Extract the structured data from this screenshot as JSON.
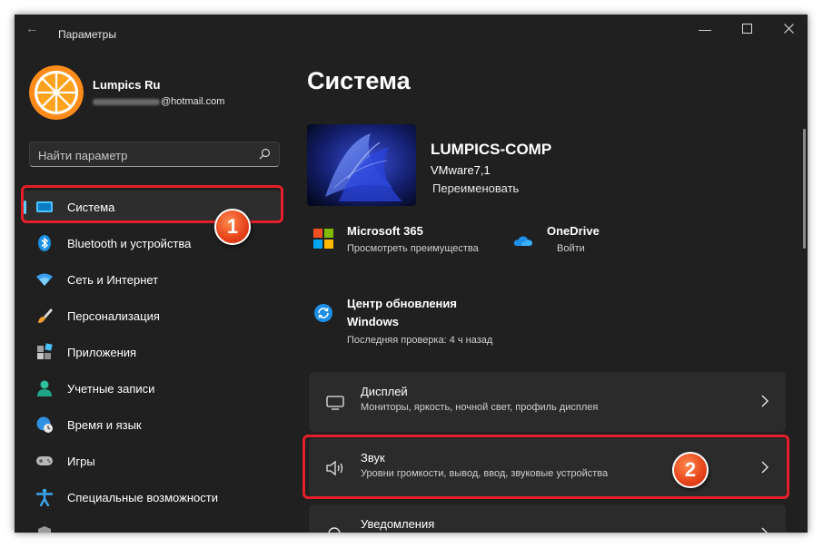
{
  "window": {
    "title": "Параметры"
  },
  "user": {
    "name": "Lumpics Ru",
    "email_domain": "@hotmail.com"
  },
  "search": {
    "placeholder": "Найти параметр"
  },
  "sidebar": {
    "items": [
      {
        "label": "Система",
        "icon": "monitor-icon",
        "selected": true
      },
      {
        "label": "Bluetooth и устройства",
        "icon": "bluetooth-icon"
      },
      {
        "label": "Сеть и Интернет",
        "icon": "wifi-icon"
      },
      {
        "label": "Персонализация",
        "icon": "brush-icon"
      },
      {
        "label": "Приложения",
        "icon": "apps-icon"
      },
      {
        "label": "Учетные записи",
        "icon": "person-icon"
      },
      {
        "label": "Время и язык",
        "icon": "globe-clock-icon"
      },
      {
        "label": "Игры",
        "icon": "gamepad-icon"
      },
      {
        "label": "Специальные возможности",
        "icon": "accessibility-icon"
      }
    ]
  },
  "main": {
    "title": "Система",
    "device": {
      "name": "LUMPICS-COMP",
      "model": "VMware7,1",
      "rename": "Переименовать"
    },
    "services": [
      {
        "title": "Microsoft 365",
        "subtitle": "Просмотреть преимущества",
        "icon": "microsoft-logo-icon"
      },
      {
        "title": "OneDrive",
        "subtitle": "Войти",
        "icon": "onedrive-cloud-icon"
      }
    ],
    "update": {
      "title_line1": "Центр обновления",
      "title_line2": "Windows",
      "subtitle": "Последняя проверка: 4 ч назад",
      "icon": "sync-icon"
    },
    "cards": [
      {
        "title": "Дисплей",
        "subtitle": "Мониторы, яркость, ночной свет, профиль дисплея",
        "icon": "display-icon"
      },
      {
        "title": "Звук",
        "subtitle": "Уровни громкости, вывод, ввод, звуковые устройства",
        "icon": "speaker-icon"
      },
      {
        "title": "Уведомления",
        "subtitle": "",
        "icon": "bell-icon"
      }
    ]
  },
  "annotations": {
    "step1": "1",
    "step2": "2"
  },
  "colors": {
    "window_bg": "#202020",
    "card_bg": "#2b2b2b",
    "accent": "#60cdff",
    "highlight": "#e3202a",
    "badge": "#e6421a"
  }
}
